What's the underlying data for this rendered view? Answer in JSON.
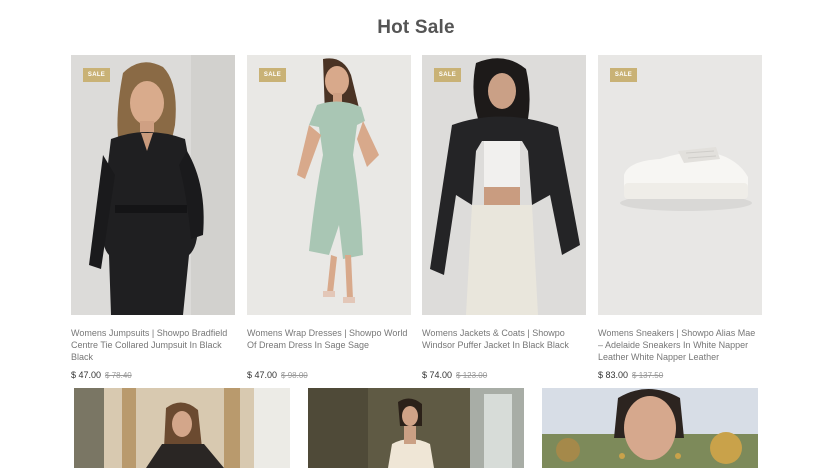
{
  "section": {
    "title": "Hot Sale"
  },
  "badge_label": "SALE",
  "products": [
    {
      "title": "Womens Jumpsuits | Showpo Bradfield Centre Tie Collared Jumpsuit In Black Black",
      "price": "$ 47.00",
      "old_price": "$ 78.40"
    },
    {
      "title": "Womens Wrap Dresses | Showpo World Of Dream Dress In Sage Sage",
      "price": "$ 47.00",
      "old_price": "$ 98.00"
    },
    {
      "title": "Womens Jackets & Coats | Showpo Windsor Puffer Jacket In Black Black",
      "price": "$ 74.00",
      "old_price": "$ 123.00"
    },
    {
      "title": "Womens Sneakers | Showpo Alias Mae – Adelaide Sneakers In White Napper Leather White Napper Leather",
      "price": "$ 83.00",
      "old_price": "$ 137.50"
    }
  ],
  "colors": {
    "badge": "#c9b276",
    "heading": "#555555",
    "price": "#333333"
  }
}
